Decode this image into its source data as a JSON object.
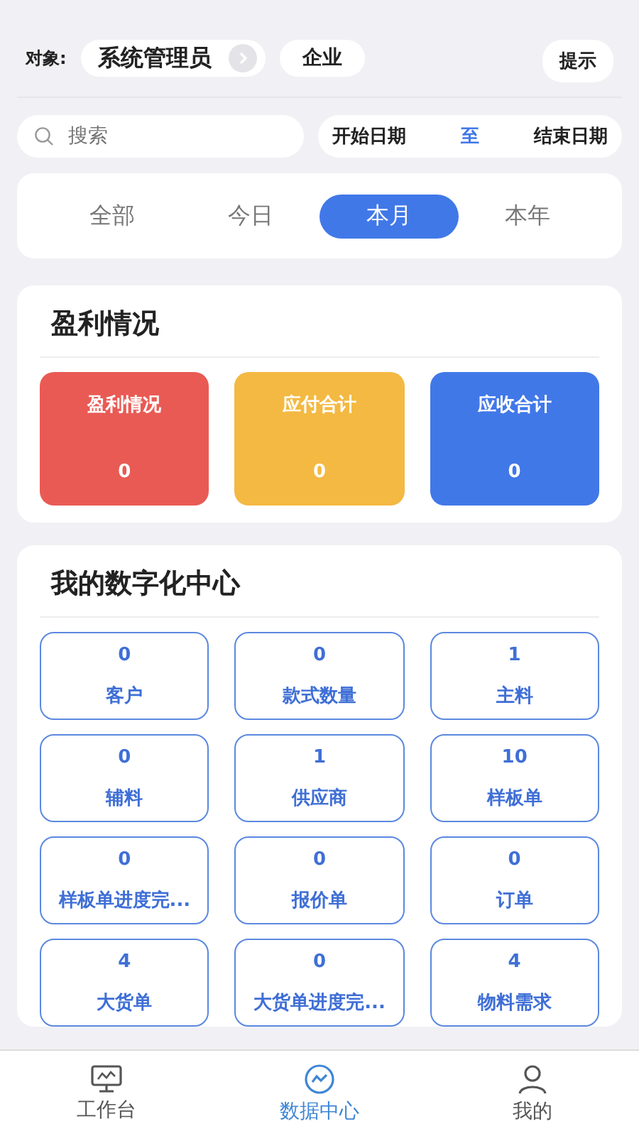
{
  "header": {
    "label": "对象:",
    "user": "系统管理员",
    "scope": "企业",
    "hint_button": "提示"
  },
  "search": {
    "placeholder": "搜索"
  },
  "date_range": {
    "start": "开始日期",
    "separator": "至",
    "end": "结束日期"
  },
  "periods": [
    {
      "label": "全部",
      "selected": false
    },
    {
      "label": "今日",
      "selected": false
    },
    {
      "label": "本月",
      "selected": true
    },
    {
      "label": "本年",
      "selected": false
    }
  ],
  "profit": {
    "title": "盈利情况",
    "tiles": [
      {
        "label": "盈利情况",
        "value": "0",
        "color": "#e95a54"
      },
      {
        "label": "应付合计",
        "value": "0",
        "color": "#f3b942"
      },
      {
        "label": "应收合计",
        "value": "0",
        "color": "#4178e8"
      }
    ]
  },
  "digital_center": {
    "title": "我的数字化中心",
    "items": [
      {
        "value": "0",
        "label": "客户"
      },
      {
        "value": "0",
        "label": "款式数量"
      },
      {
        "value": "1",
        "label": "主料"
      },
      {
        "value": "0",
        "label": "辅料"
      },
      {
        "value": "1",
        "label": "供应商"
      },
      {
        "value": "10",
        "label": "样板单"
      },
      {
        "value": "0",
        "label": "样板单进度完..."
      },
      {
        "value": "0",
        "label": "报价单"
      },
      {
        "value": "0",
        "label": "订单"
      },
      {
        "value": "4",
        "label": "大货单"
      },
      {
        "value": "0",
        "label": "大货单进度完..."
      },
      {
        "value": "4",
        "label": "物料需求"
      }
    ]
  },
  "tab_bar": [
    {
      "label": "工作台",
      "kind": "monitor",
      "selected": false
    },
    {
      "label": "数据中心",
      "kind": "chart",
      "selected": true
    },
    {
      "label": "我的",
      "kind": "person",
      "selected": false
    }
  ]
}
